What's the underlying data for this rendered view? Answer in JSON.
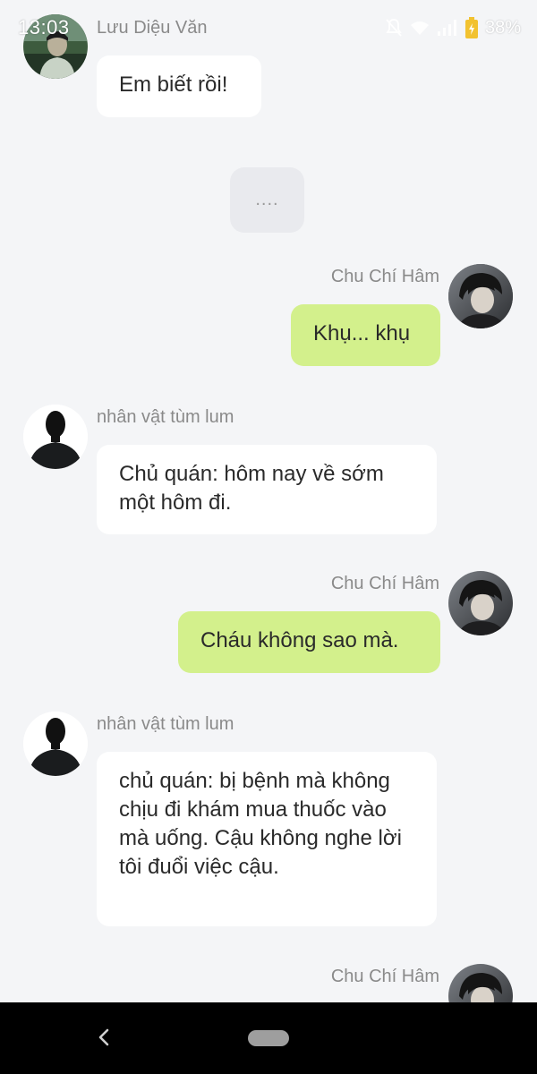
{
  "status_bar": {
    "time": "13:03",
    "battery": "38%",
    "icons": [
      "bell-off-icon",
      "wifi-icon",
      "signal-icon",
      "battery-charging-icon"
    ]
  },
  "messages": [
    {
      "sender": "Lưu Diệu Văn",
      "text": "Em biết rồi!",
      "side": "left",
      "avatar": "luu-dieu-van-avatar"
    },
    {
      "type": "system",
      "text": "...."
    },
    {
      "sender": "Chu Chí Hâm",
      "text": "Khụ... khụ",
      "side": "right",
      "avatar": "chu-chi-ham-avatar"
    },
    {
      "sender": "nhân vật tùm lum",
      "text": "Chủ quán: hôm nay về sớm một hôm đi.",
      "side": "left",
      "avatar": "silhouette-avatar"
    },
    {
      "sender": "Chu Chí Hâm",
      "text": "Cháu không sao mà.",
      "side": "right",
      "avatar": "chu-chi-ham-avatar"
    },
    {
      "sender": "nhân vật tùm lum",
      "text": "chủ quán: bị bệnh mà không chịu đi khám mua thuốc vào mà uống. Cậu không nghe lời tôi đuổi việc cậu.",
      "side": "left",
      "avatar": "silhouette-avatar"
    },
    {
      "sender": "Chu Chí Hâm",
      "side": "right",
      "avatar": "chu-chi-ham-avatar"
    }
  ],
  "nav": {
    "icons": [
      "back-icon",
      "home-pill-icon"
    ]
  },
  "colors": {
    "background": "#f4f5f7",
    "bubble_left": "#ffffff",
    "bubble_right": "#d3f08c",
    "system_bubble": "#e9eaee",
    "name_text": "#8a8a8a",
    "nav_bar": "#000000"
  }
}
